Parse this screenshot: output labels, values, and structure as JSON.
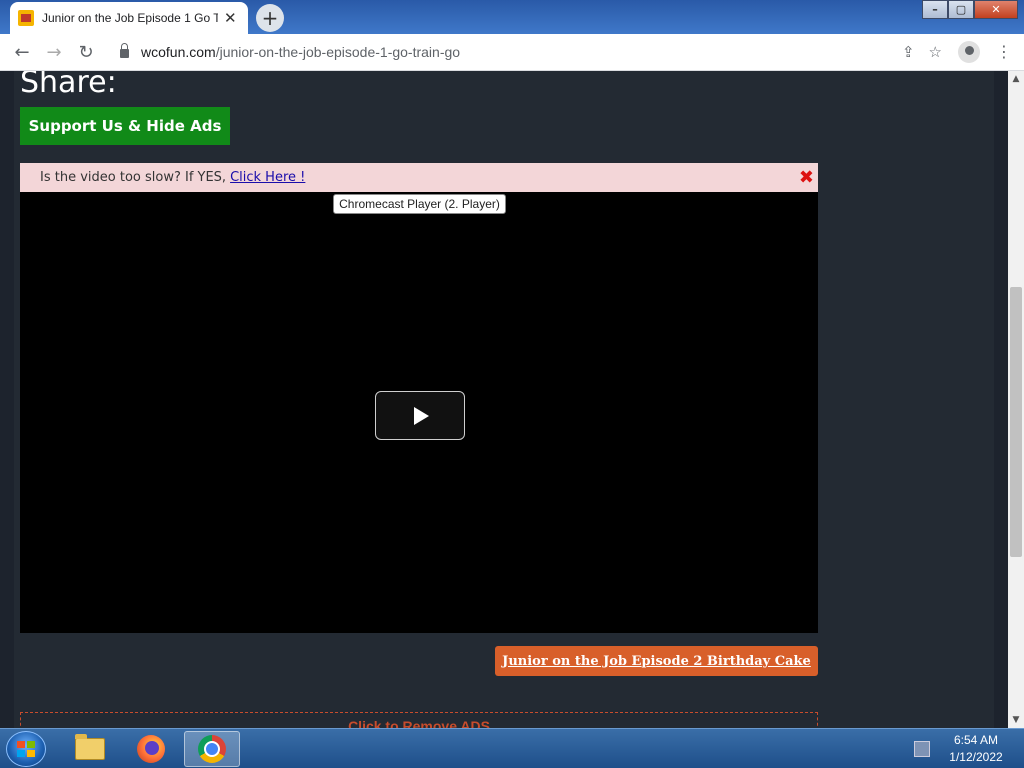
{
  "browser": {
    "tab_title": "Junior on the Job Episode 1 Go Tr",
    "tab_close": "✕",
    "new_tab": "+",
    "url_host": "wcofun.com",
    "url_path": "/junior-on-the-job-episode-1-go-train-go",
    "menu": "⋮",
    "window_controls": {
      "minimize": "–",
      "maximize": "▢",
      "close": "✕"
    }
  },
  "page": {
    "share_heading": "Share:",
    "support_button": "Support Us & Hide Ads",
    "notice_text": "Is the video too slow? If YES,",
    "notice_link": "Click Here !",
    "notice_close": "✖",
    "player_tooltip": "Chromecast Player (2. Player)",
    "next_episode": "Junior on the Job Episode 2 Birthday Cake",
    "remove_ads": "Click to Remove ADS"
  },
  "taskbar": {
    "time": "6:54 AM",
    "date": "1/12/2022",
    "apps": [
      "file-explorer",
      "firefox",
      "chrome"
    ]
  },
  "colors": {
    "page_bg": "#232a33",
    "support_green": "#118a18",
    "next_orange": "#d85f2a",
    "notice_pink": "#f3d6d8",
    "link_blue": "#1a0dab"
  }
}
